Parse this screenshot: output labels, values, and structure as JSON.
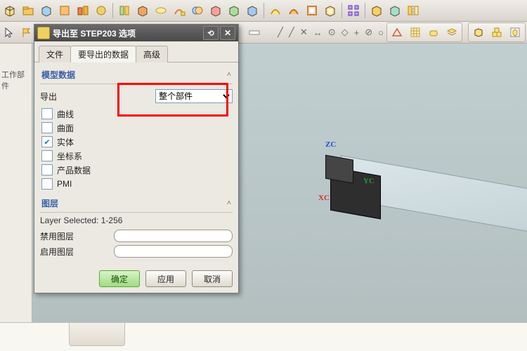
{
  "dialog": {
    "title": "导出至 STEP203 选项",
    "tabs": {
      "file": "文件",
      "data": "要导出的数据",
      "advanced": "高级"
    },
    "model_section": "模型数据",
    "export_label": "导出",
    "export_value": "整个部件",
    "checks": {
      "curve": "曲线",
      "surface": "曲面",
      "solid": "实体",
      "csys": "坐标系",
      "product_data": "产品数据",
      "pmi": "PMI"
    },
    "layer_section": "图层",
    "layer_selected": "Layer Selected: 1-256",
    "disable_layer": "禁用图层",
    "enable_layer": "启用图层",
    "buttons": {
      "ok": "确定",
      "apply": "应用",
      "cancel": "取消"
    }
  },
  "leftpanel": {
    "label": "工作部件"
  },
  "axes": {
    "x": "XC",
    "y": "YC",
    "z": "ZC"
  }
}
